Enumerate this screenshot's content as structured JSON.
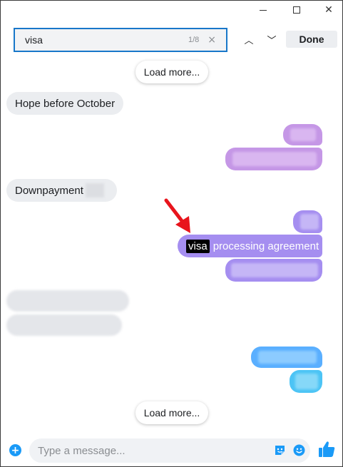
{
  "window": {
    "min_glyph": "—",
    "max_glyph": "☐",
    "close_glyph": "✕"
  },
  "search": {
    "value": "visa",
    "count": "1/8",
    "clear_glyph": "×"
  },
  "nav": {
    "up_glyph": "︿",
    "down_glyph": "﹀"
  },
  "done_label": "Done",
  "load_more_top": "Load more...",
  "load_more_bottom": "Load more...",
  "messages": {
    "m1": "Hope before October",
    "m2": "Downpayment",
    "highlight": "visa",
    "m3_rest": "processing agreement"
  },
  "composer": {
    "add_glyph": "+",
    "placeholder": "Type a message..."
  },
  "colors": {
    "accent": "#1877c9",
    "purple": "#c597e6",
    "violet": "#a58ef0",
    "blue": "#5aafff",
    "arrow": "#e8141c",
    "thumb": "#1a9af7"
  }
}
